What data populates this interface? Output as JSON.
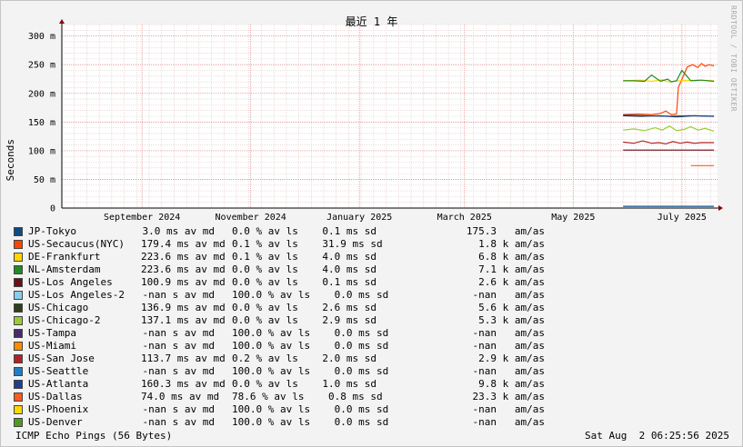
{
  "chart_data": {
    "type": "line",
    "title": "最近 1 年",
    "ylabel": "Seconds",
    "y_unit": "m",
    "ylim": [
      0,
      320
    ],
    "y_ticks": [
      {
        "value": 0,
        "label": "0"
      },
      {
        "value": 50,
        "label": "50 m"
      },
      {
        "value": 100,
        "label": "100 m"
      },
      {
        "value": 150,
        "label": "150 m"
      },
      {
        "value": 200,
        "label": "200 m"
      },
      {
        "value": 250,
        "label": "250 m"
      },
      {
        "value": 300,
        "label": "300 m"
      }
    ],
    "xlim": [
      "2024-08-01",
      "2025-08-04"
    ],
    "x_ticks": [
      {
        "date": "2024-09-15",
        "label": "September 2024"
      },
      {
        "date": "2024-11-15",
        "label": "November 2024"
      },
      {
        "date": "2025-01-15",
        "label": "January 2025"
      },
      {
        "date": "2025-03-15",
        "label": "March 2025"
      },
      {
        "date": "2025-05-15",
        "label": "May 2025"
      },
      {
        "date": "2025-07-15",
        "label": "July 2025"
      }
    ],
    "grid": true,
    "series": [
      {
        "name": "JP-Tokyo",
        "color": "#0f4c81",
        "avg": "3.0",
        "unit": "ms",
        "loss": "0.0",
        "sd_v": "0.1",
        "sd_u": "ms",
        "amas_v": "175.3",
        "amas_u": "",
        "x": [
          "2025-06-12",
          "2025-08-02"
        ],
        "values": [
          3,
          3
        ]
      },
      {
        "name": "US-Secaucus(NYC)",
        "color": "#ff4500",
        "avg": "179.4",
        "unit": "ms",
        "loss": "0.1",
        "sd_v": "31.9",
        "sd_u": "ms",
        "amas_v": "1.8",
        "amas_u": "k",
        "x": [
          "2025-06-12",
          "2025-06-20",
          "2025-06-28",
          "2025-07-03",
          "2025-07-06",
          "2025-07-09",
          "2025-07-12",
          "2025-07-13",
          "2025-07-18",
          "2025-07-21",
          "2025-07-24",
          "2025-07-26",
          "2025-07-28",
          "2025-07-30",
          "2025-08-02"
        ],
        "values": [
          163,
          164,
          163,
          165,
          169,
          163,
          164,
          210,
          246,
          250,
          245,
          252,
          247,
          250,
          248
        ]
      },
      {
        "name": "DE-Frankfurt",
        "color": "#ffd700",
        "avg": "223.6",
        "unit": "ms",
        "loss": "0.1",
        "sd_v": "4.0",
        "sd_u": "ms",
        "amas_v": "6.8",
        "amas_u": "k",
        "x": [
          "2025-06-12",
          "2025-06-22",
          "2025-06-28",
          "2025-07-04",
          "2025-07-07",
          "2025-07-14",
          "2025-07-24",
          "2025-08-02"
        ],
        "values": [
          222,
          223,
          221,
          224,
          220,
          222,
          223,
          222
        ]
      },
      {
        "name": "NL-Amsterdam",
        "color": "#228b22",
        "avg": "223.6",
        "unit": "ms",
        "loss": "0.0",
        "sd_v": "4.0",
        "sd_u": "ms",
        "amas_v": "7.1",
        "amas_u": "k",
        "x": [
          "2025-06-12",
          "2025-06-18",
          "2025-06-24",
          "2025-06-28",
          "2025-07-03",
          "2025-07-07",
          "2025-07-09",
          "2025-07-12",
          "2025-07-15",
          "2025-07-20",
          "2025-07-26",
          "2025-08-02"
        ],
        "values": [
          222,
          222,
          221,
          232,
          221,
          225,
          220,
          222,
          240,
          222,
          223,
          221
        ]
      },
      {
        "name": "US-Los Angeles",
        "color": "#6b0f1a",
        "avg": "100.9",
        "unit": "ms",
        "loss": "0.0",
        "sd_v": "0.1",
        "sd_u": "ms",
        "amas_v": "2.6",
        "amas_u": "k",
        "x": [
          "2025-06-12",
          "2025-08-02"
        ],
        "values": [
          101,
          101
        ]
      },
      {
        "name": "US-Los Angeles-2",
        "color": "#87ceeb",
        "avg": "-nan",
        "unit": "s",
        "loss": "100.0",
        "sd_v": "0.0",
        "sd_u": "ms",
        "amas_v": "-nan",
        "amas_u": "",
        "x": [],
        "values": []
      },
      {
        "name": "US-Chicago",
        "color": "#2f3f1f",
        "avg": "136.9",
        "unit": "ms",
        "loss": "0.0",
        "sd_v": "2.6",
        "sd_u": "ms",
        "amas_v": "5.6",
        "amas_u": "k",
        "x": [
          "2025-06-12",
          "2025-06-22",
          "2025-07-02",
          "2025-07-12",
          "2025-07-22",
          "2025-08-02"
        ],
        "values": [
          161,
          160,
          161,
          159,
          161,
          160
        ]
      },
      {
        "name": "US-Chicago-2",
        "color": "#9acd32",
        "avg": "137.1",
        "unit": "ms",
        "loss": "0.0",
        "sd_v": "2.9",
        "sd_u": "ms",
        "amas_v": "5.3",
        "amas_u": "k",
        "x": [
          "2025-06-12",
          "2025-06-18",
          "2025-06-24",
          "2025-06-30",
          "2025-07-04",
          "2025-07-08",
          "2025-07-12",
          "2025-07-16",
          "2025-07-20",
          "2025-07-24",
          "2025-07-28",
          "2025-08-02"
        ],
        "values": [
          136,
          138,
          135,
          140,
          136,
          143,
          135,
          137,
          142,
          136,
          139,
          134
        ]
      },
      {
        "name": "US-Tampa",
        "color": "#4b2a6b",
        "avg": "-nan",
        "unit": "s",
        "loss": "100.0",
        "sd_v": "0.0",
        "sd_u": "ms",
        "amas_v": "-nan",
        "amas_u": "",
        "x": [],
        "values": []
      },
      {
        "name": "US-Miami",
        "color": "#ff8c00",
        "avg": "-nan",
        "unit": "s",
        "loss": "100.0",
        "sd_v": "0.0",
        "sd_u": "ms",
        "amas_v": "-nan",
        "amas_u": "",
        "x": [],
        "values": []
      },
      {
        "name": "US-San Jose",
        "color": "#b22222",
        "avg": "113.7",
        "unit": "ms",
        "loss": "0.2",
        "sd_v": "2.0",
        "sd_u": "ms",
        "amas_v": "2.9",
        "amas_u": "k",
        "x": [
          "2025-06-12",
          "2025-06-18",
          "2025-06-23",
          "2025-06-28",
          "2025-07-02",
          "2025-07-06",
          "2025-07-10",
          "2025-07-14",
          "2025-07-18",
          "2025-07-22",
          "2025-07-26",
          "2025-08-02"
        ],
        "values": [
          115,
          113,
          117,
          113,
          114,
          112,
          116,
          113,
          115,
          113,
          114,
          114
        ]
      },
      {
        "name": "US-Seattle",
        "color": "#1e7fc4",
        "avg": "-nan",
        "unit": "s",
        "loss": "100.0",
        "sd_v": "0.0",
        "sd_u": "ms",
        "amas_v": "-nan",
        "amas_u": "",
        "x": [],
        "values": []
      },
      {
        "name": "US-Atlanta",
        "color": "#1f3f8f",
        "avg": "160.3",
        "unit": "ms",
        "loss": "0.0",
        "sd_v": "1.0",
        "sd_u": "ms",
        "amas_v": "9.8",
        "amas_u": "k",
        "x": [
          "2025-06-12",
          "2025-06-25",
          "2025-07-08",
          "2025-07-20",
          "2025-08-02"
        ],
        "values": [
          162,
          161,
          160,
          161,
          160
        ]
      },
      {
        "name": "US-Dallas",
        "color": "#ff5a1f",
        "avg": "74.0",
        "unit": "ms",
        "loss": "78.6",
        "sd_v": "0.8",
        "sd_u": "ms",
        "amas_v": "23.3",
        "amas_u": "k",
        "x": [
          "2025-07-20",
          "2025-08-02"
        ],
        "values": [
          74,
          74
        ]
      },
      {
        "name": "US-Phoenix",
        "color": "#ffd700",
        "avg": "-nan",
        "unit": "s",
        "loss": "100.0",
        "sd_v": "0.0",
        "sd_u": "ms",
        "amas_v": "-nan",
        "amas_u": "",
        "x": [],
        "values": []
      },
      {
        "name": "US-Denver",
        "color": "#4f9a1f",
        "avg": "-nan",
        "unit": "s",
        "loss": "100.0",
        "sd_v": "0.0",
        "sd_u": "ms",
        "amas_v": "-nan",
        "amas_u": "",
        "x": [],
        "values": []
      }
    ]
  },
  "legend_words": {
    "avg": "av md",
    "loss": "% av ls",
    "sd": "sd",
    "amas": "am/as"
  },
  "watermark": "RRDTOOL / TOBI OETIKER",
  "footer": {
    "probe": "ICMP Echo Pings (56 Bytes)",
    "timestamp": "Sat Aug  2 06:25:56 2025"
  }
}
